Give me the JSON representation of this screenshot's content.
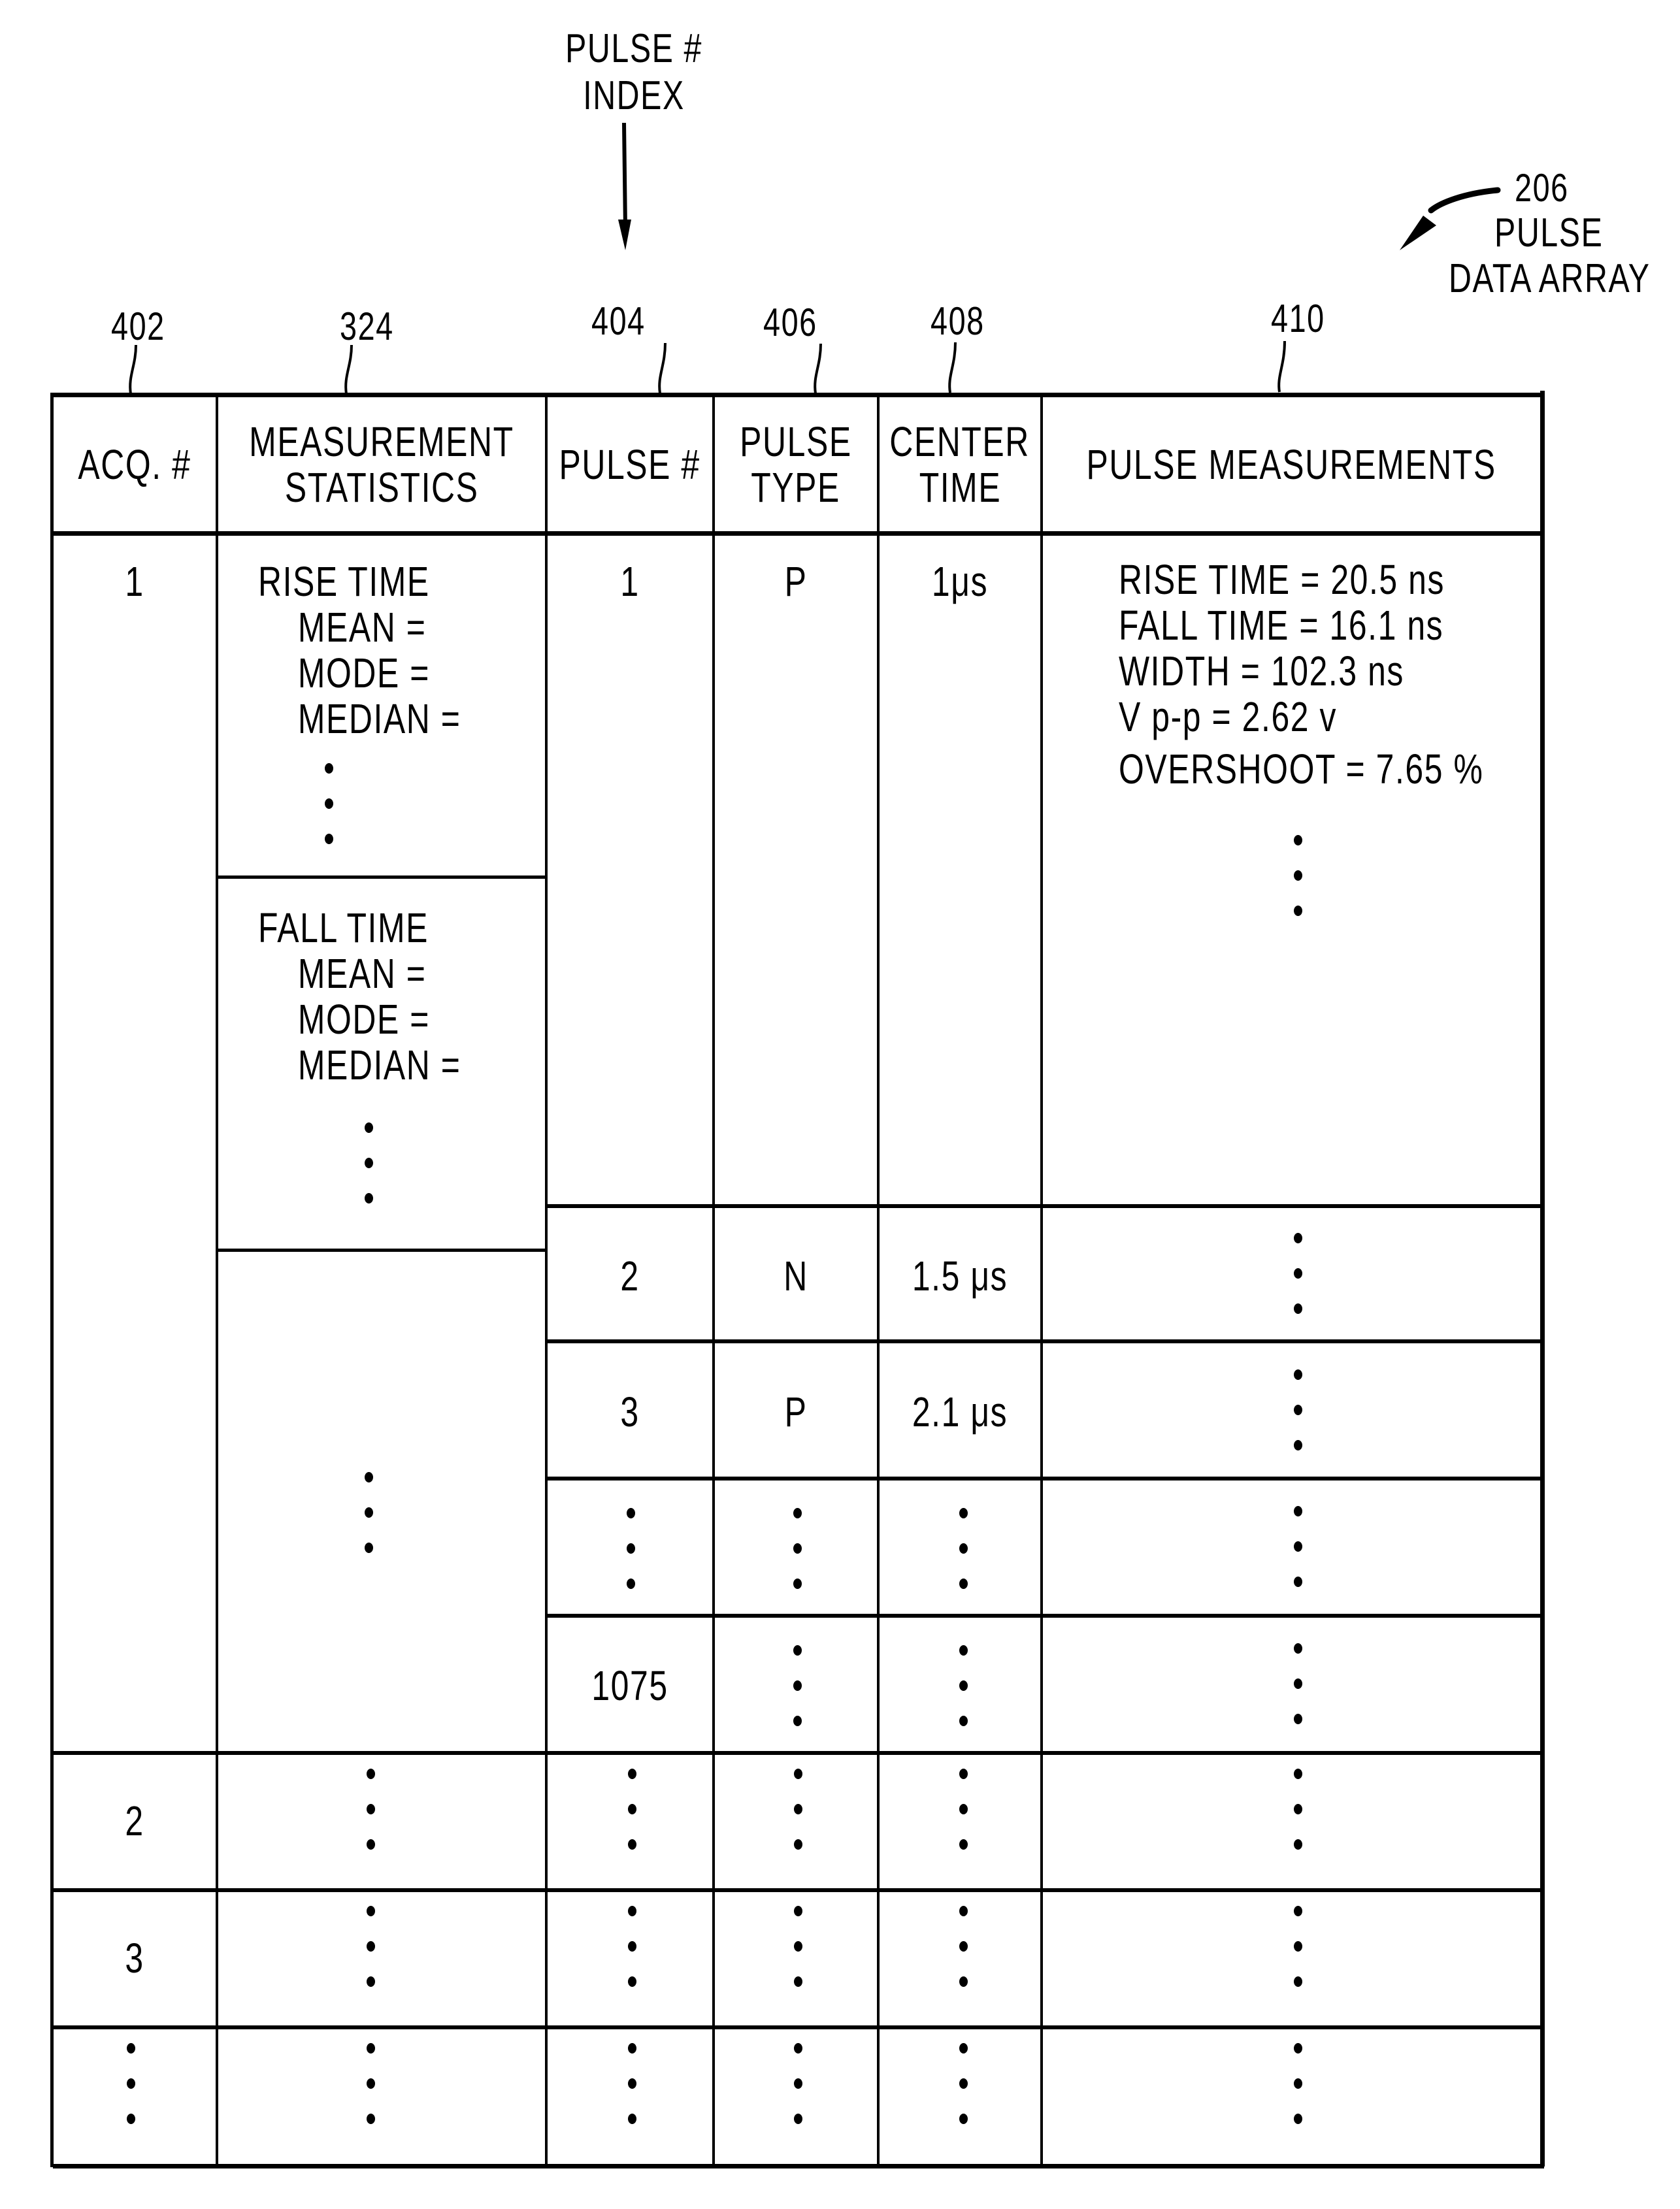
{
  "figure": {
    "index_callout": {
      "line1": "PULSE #",
      "line2": "INDEX"
    },
    "array_callout": {
      "ref": "206",
      "line1": "PULSE",
      "line2": "DATA ARRAY"
    },
    "column_refs": [
      "402",
      "324",
      "404",
      "406",
      "408",
      "410"
    ]
  },
  "table": {
    "headers": {
      "acq": "ACQ. #",
      "stats_line1": "MEASUREMENT",
      "stats_line2": "STATISTICS",
      "pulse_num": "PULSE #",
      "type_line1": "PULSE",
      "type_line2": "TYPE",
      "center_line1": "CENTER",
      "center_line2": "TIME",
      "measurements": "PULSE MEASUREMENTS"
    },
    "acquisition_1": {
      "acq": "1",
      "rise_stats": {
        "title": "RISE TIME",
        "items": [
          "MEAN =",
          "MODE =",
          "MEDIAN ="
        ]
      },
      "fall_stats": {
        "title": "FALL TIME",
        "items": [
          "MEAN =",
          "MODE =",
          "MEDIAN ="
        ]
      },
      "pulses": [
        {
          "num": "1",
          "type": "P",
          "center_time": "1μs",
          "measurements": [
            "RISE TIME = 20.5 ns",
            "FALL TIME = 16.1 ns",
            "WIDTH = 102.3 ns",
            "V p-p = 2.62 v",
            "OVERSHOOT = 7.65 %"
          ]
        },
        {
          "num": "2",
          "type": "N",
          "center_time": "1.5 μs"
        },
        {
          "num": "3",
          "type": "P",
          "center_time": "2.1 μs"
        },
        {
          "num": "⋮",
          "type": "⋮",
          "center_time": "⋮"
        },
        {
          "num": "1075",
          "type": "⋮",
          "center_time": "⋮"
        }
      ]
    },
    "more_acquisitions": [
      {
        "acq": "2"
      },
      {
        "acq": "3"
      },
      {
        "acq": "⋮"
      }
    ],
    "ellipsis_symbol": "vertical-ellipsis"
  }
}
